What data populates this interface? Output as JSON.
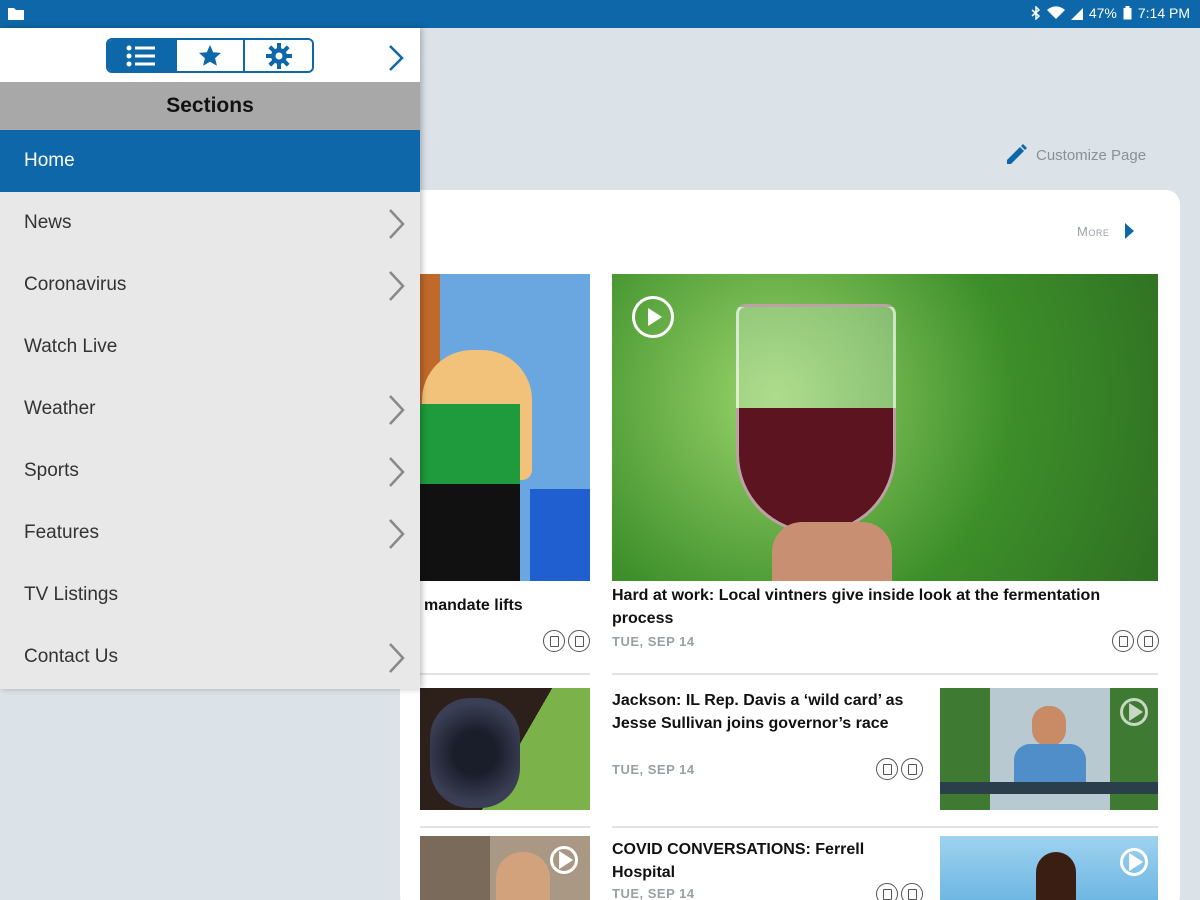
{
  "status_bar": {
    "battery": "47%",
    "time": "7:14 PM",
    "icons": [
      "folder-icon",
      "bluetooth-icon",
      "wifi-icon",
      "signal-icon",
      "battery-icon"
    ]
  },
  "header": {
    "customize_label": "Customize Page"
  },
  "drawer": {
    "tabs": [
      "list-icon",
      "star-icon",
      "gear-icon"
    ],
    "sections_title": "Sections",
    "items": [
      {
        "label": "Home",
        "active": true,
        "has_children": false
      },
      {
        "label": "News",
        "has_children": true
      },
      {
        "label": "Coronavirus",
        "has_children": true
      },
      {
        "label": "Watch Live",
        "has_children": false
      },
      {
        "label": "Weather",
        "has_children": true
      },
      {
        "label": "Sports",
        "has_children": true
      },
      {
        "label": "Features",
        "has_children": true
      },
      {
        "label": "TV Listings",
        "has_children": false
      },
      {
        "label": "Contact Us",
        "has_children": true
      }
    ]
  },
  "feed": {
    "more_label": "More",
    "stories": [
      {
        "headline": "mandate lifts",
        "date": ""
      },
      {
        "headline": "Hard at work: Local vintners give inside look at the fermentation process",
        "date": "TUE, SEP 14"
      },
      {
        "headline": "Jackson: IL Rep. Davis a ‘wild card’ as Jesse Sullivan joins governor’s race",
        "date": "TUE, SEP 14"
      },
      {
        "headline": "COVID CONVERSATIONS: Ferrell Hospital",
        "date": "TUE, SEP 14"
      }
    ]
  },
  "colors": {
    "accent": "#0d67a8",
    "drawer_bg": "#e8e8e8",
    "page_bg": "#dbe3e8"
  }
}
